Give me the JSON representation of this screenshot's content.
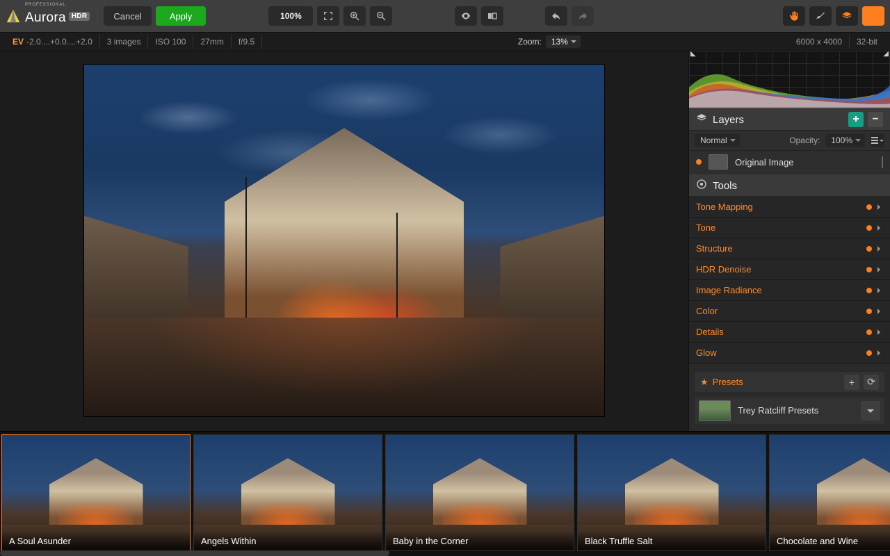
{
  "app": {
    "name": "Aurora",
    "edition": "PROFESSIONAL",
    "badge": "HDR"
  },
  "toolbar": {
    "cancel": "Cancel",
    "apply": "Apply",
    "zoom_pct": "100%"
  },
  "infobar": {
    "ev_label": "EV",
    "ev_values": "-2.0....+0.0....+2.0",
    "images": "3 images",
    "iso": "ISO 100",
    "focal": "27mm",
    "aperture": "f/9.5",
    "zoom_label": "Zoom:",
    "zoom_value": "13%",
    "dimensions": "6000 x 4000",
    "bit_depth": "32-bit"
  },
  "layers": {
    "title": "Layers",
    "blend_mode": "Normal",
    "opacity_label": "Opacity:",
    "opacity_value": "100%",
    "row_name": "Original Image"
  },
  "tools_panel": {
    "title": "Tools",
    "items": [
      "Tone Mapping",
      "Tone",
      "Structure",
      "HDR Denoise",
      "Image Radiance",
      "Color",
      "Details",
      "Glow"
    ]
  },
  "presets": {
    "label": "Presets",
    "collection": "Trey Ratcliff Presets",
    "cards": [
      "A Soul Asunder",
      "Angels Within",
      "Baby in the Corner",
      "Black Truffle Salt",
      "Chocolate and Wine"
    ]
  }
}
